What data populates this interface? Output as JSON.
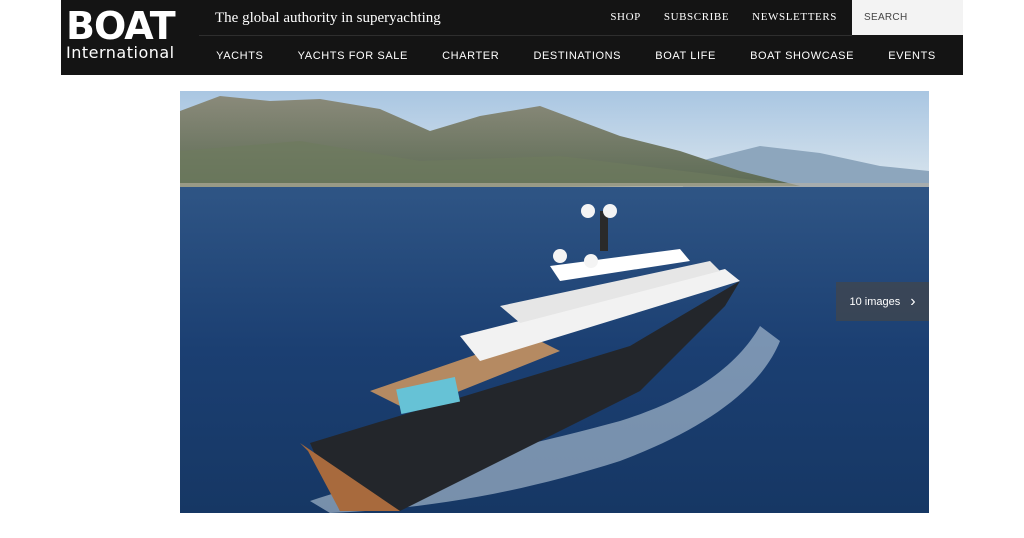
{
  "brand": {
    "logo_main": "BOAT",
    "logo_sub": "International",
    "tagline": "The global authority in superyachting"
  },
  "top_links": [
    "SHOP",
    "SUBSCRIBE",
    "NEWSLETTERS"
  ],
  "search": {
    "placeholder": "SEARCH"
  },
  "nav": [
    "YACHTS",
    "YACHTS FOR SALE",
    "CHARTER",
    "DESTINATIONS",
    "BOAT LIFE",
    "BOAT SHOWCASE",
    "EVENTS"
  ],
  "hero": {
    "gallery_label": "10 images",
    "chevron": "›",
    "image_icon": "superyacht-photo"
  },
  "colors": {
    "header_bg": "#141414",
    "sea": "#1d3f73",
    "sky": "#c8dbe9"
  }
}
